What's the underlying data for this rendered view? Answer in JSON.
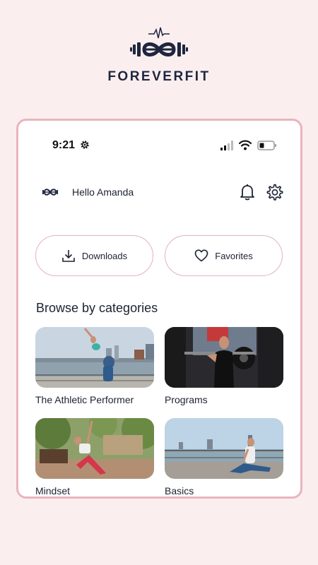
{
  "brand": {
    "name": "FOREVERFIT",
    "logo_icon": "dumbbell-infinity-logo-icon",
    "colors": {
      "navy": "#1e2640",
      "pink_border": "#e9b5bd",
      "background": "#fbeeee"
    }
  },
  "status_bar": {
    "time": "9:21",
    "icons": [
      "gear-icon",
      "signal-icon",
      "wifi-icon",
      "battery-icon"
    ]
  },
  "header": {
    "greeting": "Hello Amanda",
    "icons": [
      "notification-bell-icon",
      "settings-gear-icon"
    ]
  },
  "quick_actions": [
    {
      "label": "Downloads",
      "icon": "download-icon"
    },
    {
      "label": "Favorites",
      "icon": "heart-icon"
    }
  ],
  "section": {
    "title": "Browse by categories"
  },
  "categories": [
    {
      "label": "The Athletic Performer"
    },
    {
      "label": "Programs"
    },
    {
      "label": "Mindset"
    },
    {
      "label": "Basics"
    }
  ]
}
